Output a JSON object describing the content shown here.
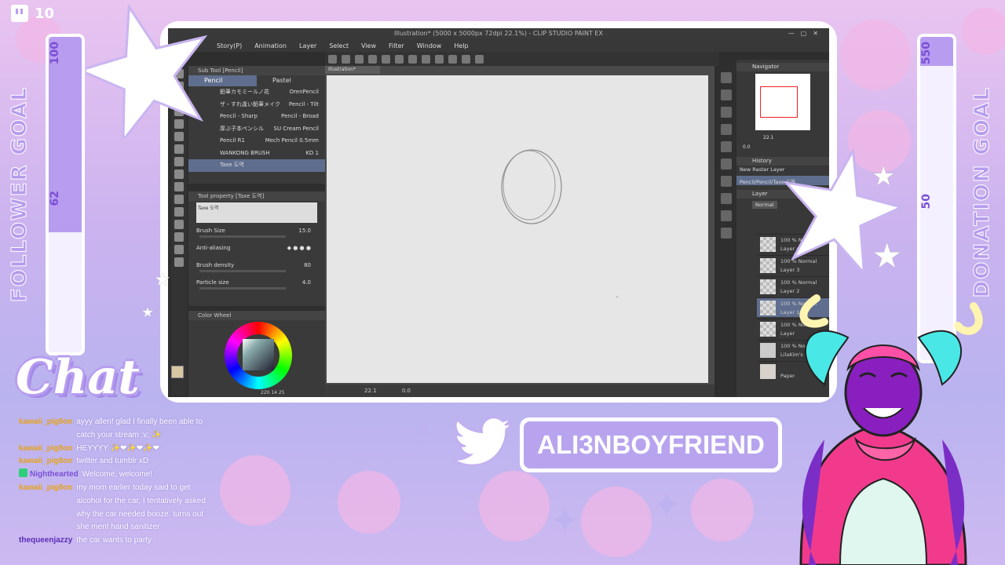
{
  "twitch": {
    "viewer_count": "10",
    "icon": "twitch-icon"
  },
  "follower_goal": {
    "label": "FOLLOWER GOAL",
    "target": "100",
    "current": "62",
    "progress": 0.62
  },
  "donation_goal": {
    "label": "DONATION GOAL",
    "target": "550",
    "current": "50",
    "progress": 0.09
  },
  "app": {
    "window_title": "Illustration* (5000 x 5000px 72dpi 22.1%) - CLIP STUDIO PAINT EX",
    "menu": [
      "Story(P)",
      "Animation",
      "Layer",
      "Select",
      "View",
      "Filter",
      "Window",
      "Help"
    ],
    "subtool": {
      "title": "Sub Tool [Pencil]",
      "tabs": [
        "Pencil",
        "Pastel"
      ],
      "brushes": [
        {
          "left": "鉛筆カモミールノ花",
          "right": "OrenPencil"
        },
        {
          "left": "ザ・すれ逢い鉛筆メイク",
          "right": "Pencil - Tilt"
        },
        {
          "left": "Pencil - Sharp",
          "right": "Pencil - Broad"
        },
        {
          "left": "厚ぶ子本ペンシル",
          "right": "SU Cream Pencil"
        },
        {
          "left": "Pencil R1",
          "right": "Mech Pencil 0.5mm"
        },
        {
          "left": "WANKONG BRUSH",
          "right": "KD 1"
        },
        {
          "left": "Taxe 도역",
          "right": ""
        }
      ]
    },
    "tool_property": {
      "title": "Tool property [Taxe 도역]",
      "preset": "Taxe 도역",
      "brush_size_label": "Brush Size",
      "brush_size_value": "15.0",
      "anti_aliasing_label": "Anti-aliasing",
      "brush_density_label": "Brush density",
      "brush_density_value": "80",
      "particle_size_label": "Particle size",
      "particle_size_value": "4.0"
    },
    "color_panel": {
      "title": "Color Wheel",
      "readout": "220 14 25"
    },
    "canvas": {
      "tab": "Illustration*",
      "zoom": "22.1",
      "angle": "0.0"
    },
    "navigator": {
      "title": "Navigator",
      "zoom": "22.1",
      "angle": "0.0"
    },
    "history": {
      "title": "History",
      "items": [
        "New Raster Layer",
        "Pencil/Pencil/Taxe 도역"
      ]
    },
    "layers": {
      "title": "Layer",
      "blend_mode": "Normal",
      "rows": [
        {
          "opacity": "100 % Normal",
          "name": "Layer 4"
        },
        {
          "opacity": "100 % Normal",
          "name": "Layer 3"
        },
        {
          "opacity": "100 % Normal",
          "name": "Layer 2"
        },
        {
          "opacity": "100 % Normal",
          "name": "Layer 1"
        },
        {
          "opacity": "100 % Normal",
          "name": "Layer"
        },
        {
          "opacity": "100 % Normal",
          "name": "LilaKim's BKG"
        },
        {
          "opacity": "",
          "name": "Paper"
        }
      ]
    }
  },
  "chat": {
    "title": "Chat",
    "messages": [
      {
        "user": "kawaii_pig8on",
        "color": "#e6a21a",
        "text": "ayyy allen! glad I finally been able to catch your stream ;v; ✨"
      },
      {
        "user": "kawaii_pig8on",
        "color": "#e6a21a",
        "text": "HEYYYY ✨❤✨❤✨❤"
      },
      {
        "user": "kawaii_pig8on",
        "color": "#e6a21a",
        "text": "twitter and tumblr xD"
      },
      {
        "user": "Nighthearted",
        "color": "#7b4fd6",
        "text": "Welcome, welcome!"
      },
      {
        "user": "kawaii_pig8on",
        "color": "#e6a21a",
        "text": "my mom earlier today said to get alcohol for the car, I tentatively asked why the car needed booze. turns out she ment hand sanitizer"
      },
      {
        "user": "thequeenjazzy",
        "color": "#5a2db8",
        "text": "the car wants to party"
      }
    ]
  },
  "social": {
    "twitter_handle": "ALI3NBOYFRIEND",
    "icon": "twitter-bird-icon"
  },
  "colors": {
    "accent": "#b89cf0",
    "frame": "#ffffff",
    "app_bg": "#2e2e2e"
  }
}
